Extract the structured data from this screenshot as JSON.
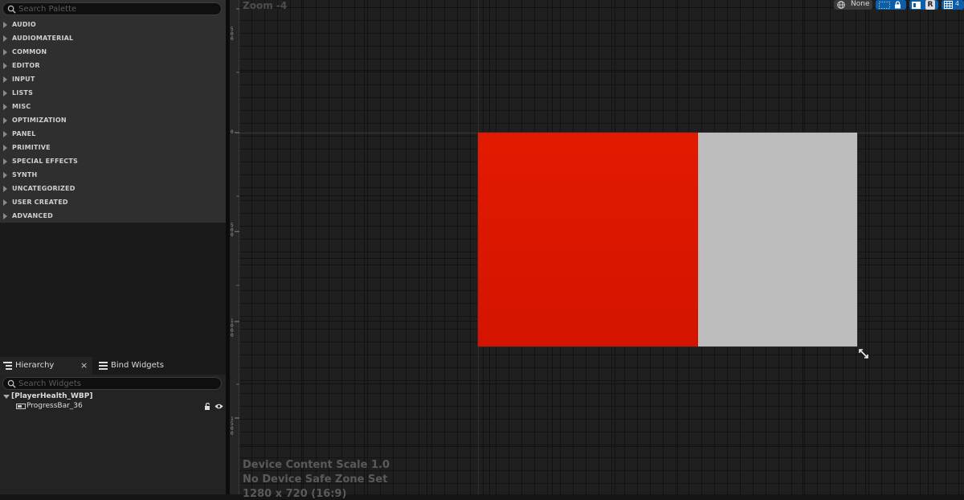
{
  "palette": {
    "search_placeholder": "Search Palette",
    "categories": [
      "AUDIO",
      "AUDIOMATERIAL",
      "COMMON",
      "EDITOR",
      "INPUT",
      "LISTS",
      "MISC",
      "OPTIMIZATION",
      "PANEL",
      "PRIMITIVE",
      "SPECIAL EFFECTS",
      "SYNTH",
      "UNCATEGORIZED",
      "USER CREATED",
      "ADVANCED"
    ]
  },
  "tabs": {
    "hierarchy": "Hierarchy",
    "close": "×",
    "bind_widgets": "Bind Widgets"
  },
  "hierarchy": {
    "search_placeholder": "Search Widgets",
    "root": "[PlayerHealth_WBP]",
    "child": "ProgressBar_36"
  },
  "ruler": {
    "labels": [
      [
        "5",
        "0",
        "0"
      ],
      [
        "0"
      ],
      [
        "5",
        "0",
        "0"
      ],
      [
        "1",
        "0",
        "0",
        "0"
      ],
      [
        "1",
        "5",
        "0",
        "0"
      ]
    ]
  },
  "canvas": {
    "zoom": "Zoom -4",
    "info_lines": [
      "Device Content Scale 1.0",
      "No Device Safe Zone Set",
      "1280 x 720 (16:9)"
    ]
  },
  "toolbar": {
    "none_label": "None",
    "r_label": "R",
    "grid_label": "4"
  },
  "widget": {
    "progress_percent": 58,
    "fill_color": "#e01a00",
    "background_color": "#bdbdbd"
  }
}
